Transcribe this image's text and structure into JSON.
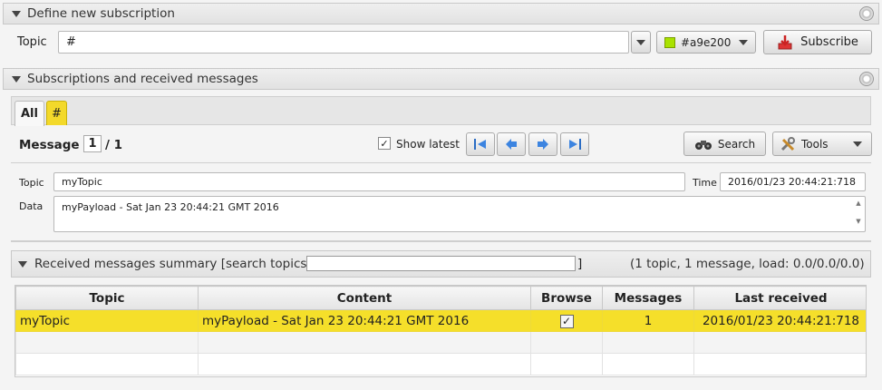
{
  "subscription_panel": {
    "title": "Define new subscription",
    "topic_label": "Topic",
    "topic_value": "#",
    "color_value": "#a9e200",
    "color_swatch": "#a9e200",
    "subscribe_label": "Subscribe"
  },
  "messages_panel": {
    "title": "Subscriptions and received messages",
    "tabs": [
      {
        "label": "All",
        "active": true
      },
      {
        "label": "#",
        "color": "#f3d92a"
      }
    ],
    "message_label": "Message",
    "message_index": "1",
    "message_total": "/ 1",
    "show_latest_label": "Show latest",
    "show_latest_checked": true,
    "search_label": "Search",
    "tools_label": "Tools",
    "topic_label": "Topic",
    "topic_value": "myTopic",
    "time_label": "Time",
    "time_value": "2016/01/23 20:44:21:718",
    "data_label": "Data",
    "data_value": "myPayload - Sat Jan 23 20:44:21 GMT 2016"
  },
  "summary": {
    "title": "Received messages summary [search topics:",
    "title_end": "]",
    "stats": "(1 topic, 1 message, load: 0.0/0.0/0.0)",
    "columns": [
      "Topic",
      "Content",
      "Browse",
      "Messages",
      "Last received"
    ],
    "rows": [
      {
        "topic": "myTopic",
        "content": "myPayload - Sat Jan 23 20:44:21 GMT 2016",
        "browse": true,
        "messages": "1",
        "last_received": "2016/01/23 20:44:21:718"
      }
    ]
  }
}
